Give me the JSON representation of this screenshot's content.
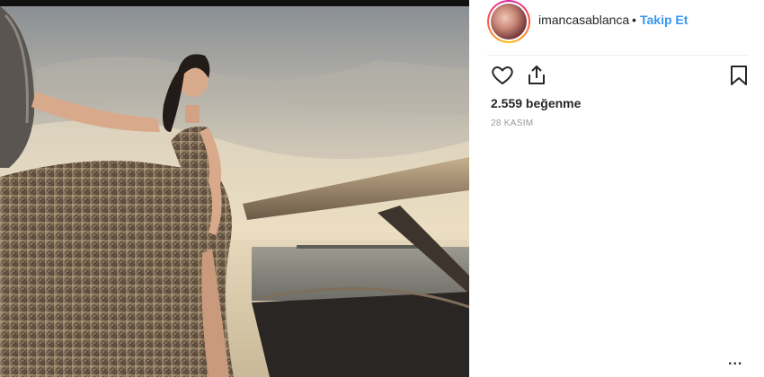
{
  "post": {
    "username": "imancasablanca",
    "separator": "•",
    "follow_label": "Takip Et",
    "likes_text": "2.559 beğenme",
    "date_text": "28 KASIM",
    "more_label": "..."
  },
  "icons": {
    "like": "heart-icon",
    "share": "share-icon",
    "save": "bookmark-icon",
    "more": "more-options-icon"
  },
  "colors": {
    "follow": "#3897f0",
    "text": "#262626",
    "muted": "#999999"
  }
}
